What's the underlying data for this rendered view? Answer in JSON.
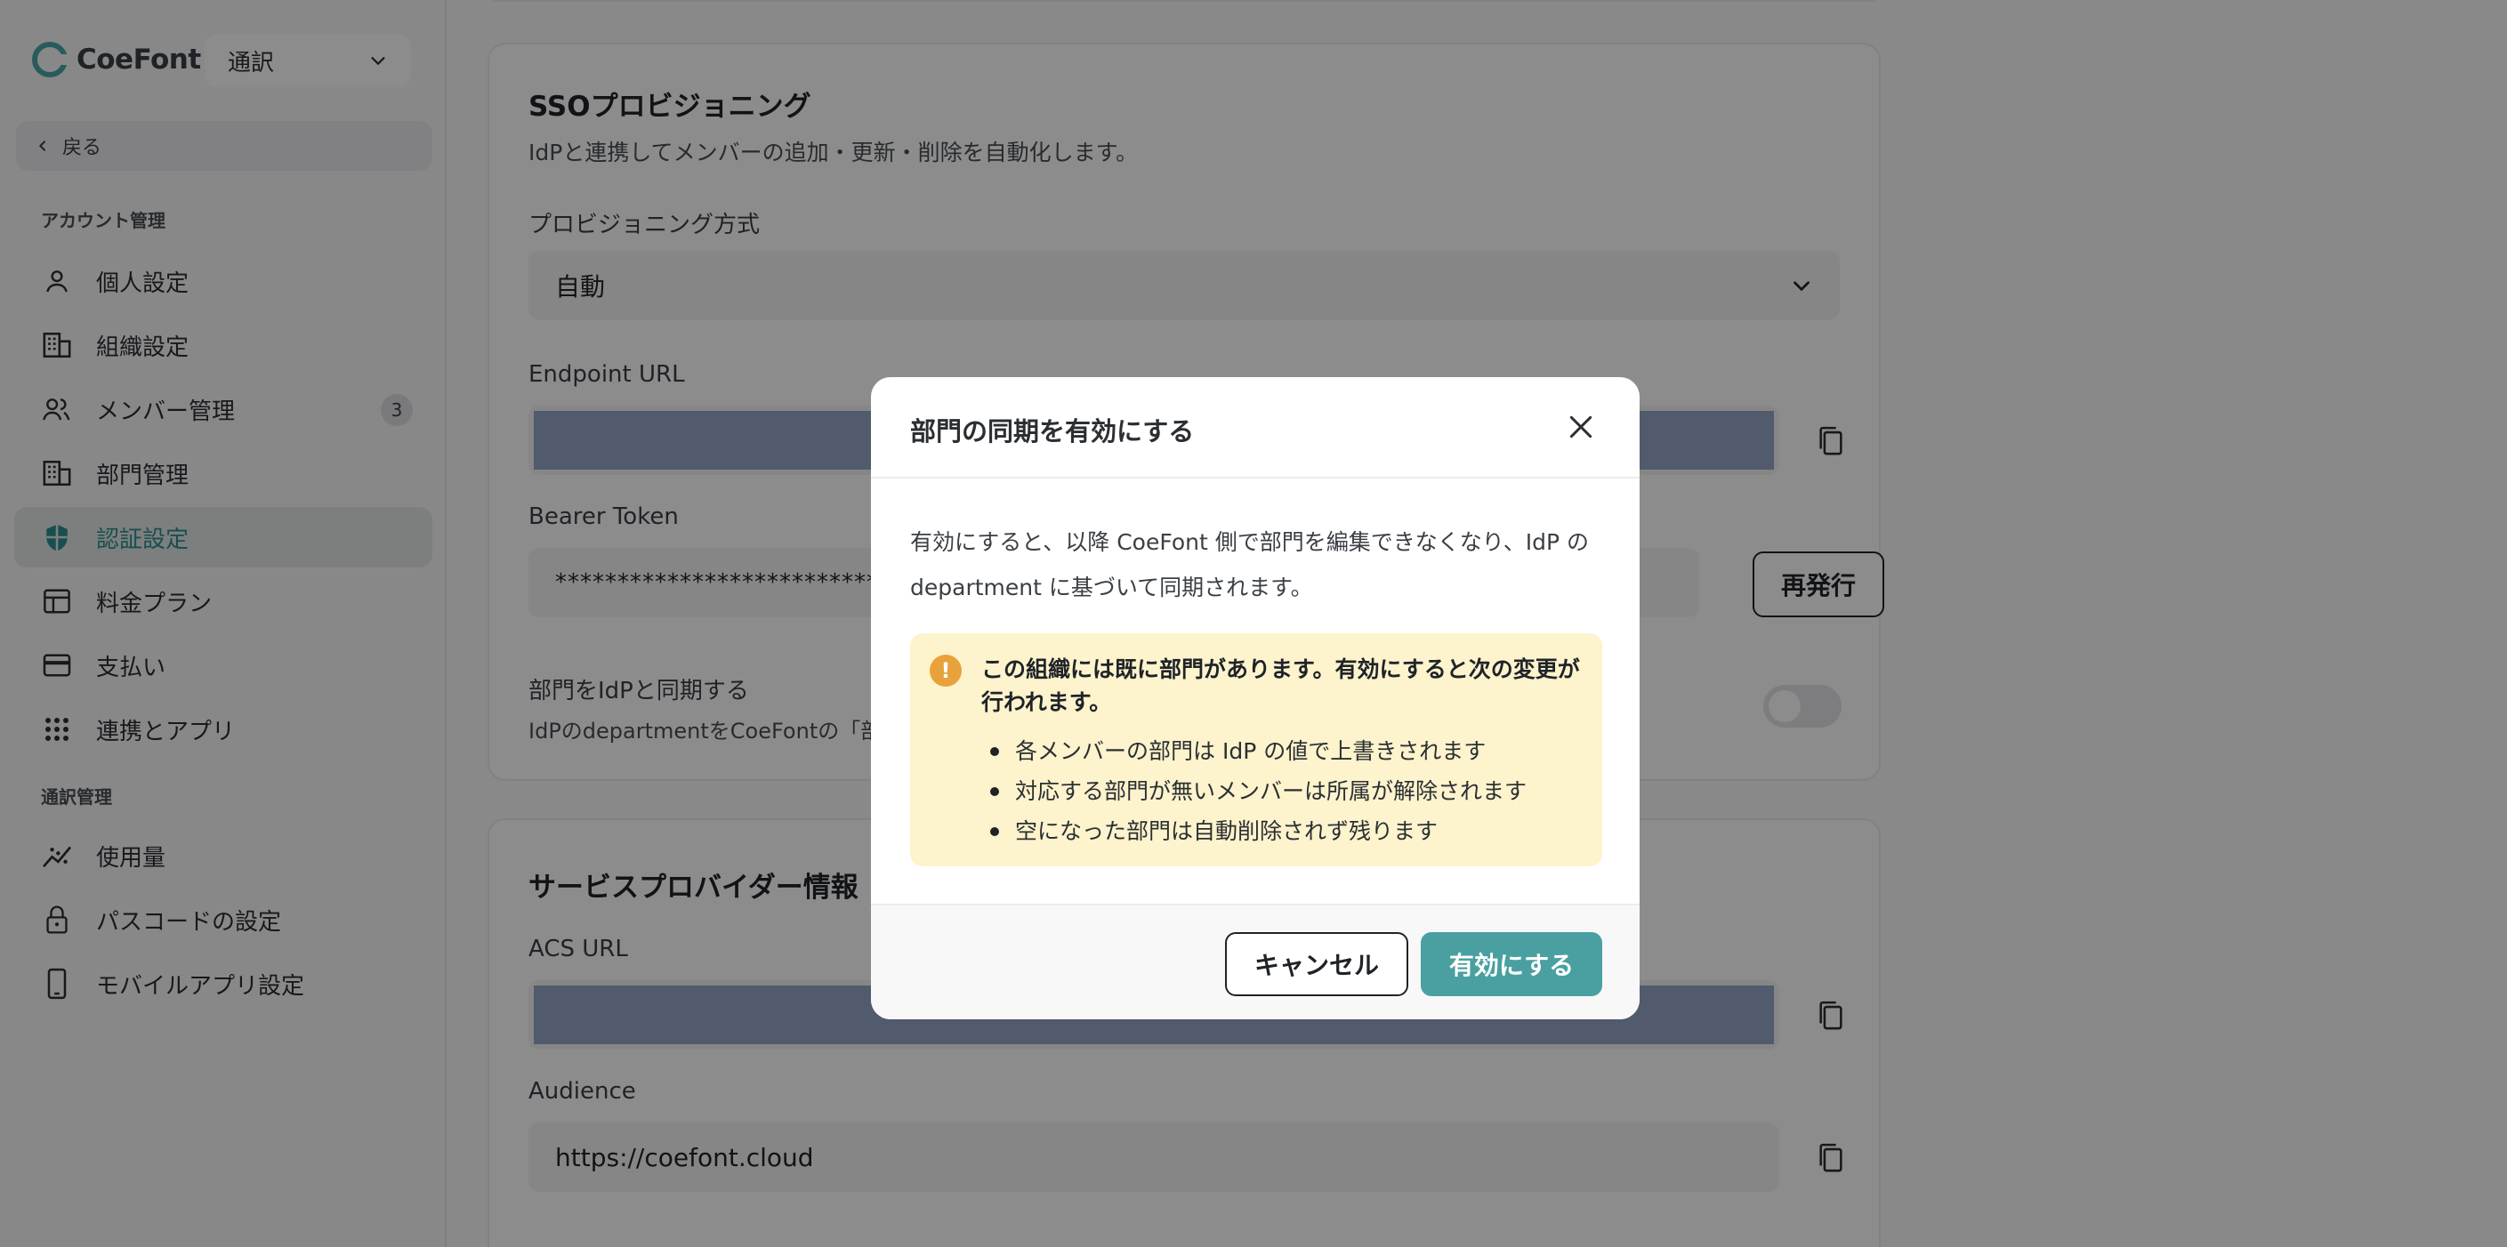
{
  "brand": {
    "name": "CoeFont"
  },
  "mode_select": {
    "value": "通訳"
  },
  "back": {
    "label": "戻る"
  },
  "sidebar": {
    "account_section": "アカウント管理",
    "account_items": [
      {
        "label": "個人設定",
        "icon": "user-icon"
      },
      {
        "label": "組織設定",
        "icon": "building-icon"
      },
      {
        "label": "メンバー管理",
        "icon": "users-icon",
        "badge": "3"
      },
      {
        "label": "部門管理",
        "icon": "building-icon"
      },
      {
        "label": "認証設定",
        "icon": "shield-icon",
        "active": true
      },
      {
        "label": "料金プラン",
        "icon": "calendar-table-icon"
      },
      {
        "label": "支払い",
        "icon": "credit-card-icon"
      },
      {
        "label": "連携とアプリ",
        "icon": "grid-dots-icon"
      }
    ],
    "interp_section": "通訳管理",
    "interp_items": [
      {
        "label": "使用量",
        "icon": "chart-line-icon"
      },
      {
        "label": "パスコードの設定",
        "icon": "lock-icon"
      },
      {
        "label": "モバイルアプリ設定",
        "icon": "mobile-icon"
      }
    ]
  },
  "sso": {
    "title": "SSOプロビジョニング",
    "description": "IdPと連携してメンバーの追加・更新・削除を自動化します。",
    "method_label": "プロビジョニング方式",
    "method_value": "自動",
    "endpoint_label": "Endpoint URL",
    "token_label": "Bearer Token",
    "token_value": "**********************************************",
    "reissue_label": "再発行",
    "sync_label": "部門をIdPと同期する",
    "sync_desc": "IdPのdepartmentをCoeFontの「部門"
  },
  "sp": {
    "title": "サービスプロバイダー情報",
    "acs_label": "ACS URL",
    "audience_label": "Audience",
    "audience_value": "https://coefont.cloud"
  },
  "modal": {
    "title": "部門の同期を有効にする",
    "body": "有効にすると、以降 CoeFont 側で部門を編集できなくなり、IdP の department に基づいて同期されます。",
    "warning_title": "この組織には既に部門があります。有効にすると次の変更が行われます。",
    "warning_items": [
      "各メンバーの部門は IdP の値で上書きされます",
      "対応する部門が無いメンバーは所属が解除されます",
      "空になった部門は自動削除されず残ります"
    ],
    "cancel_label": "キャンセル",
    "confirm_label": "有効にする"
  },
  "colors": {
    "accent": "#4aa0a0",
    "warning_bg": "#fdf3cc",
    "warning_icon": "#e9a23b"
  }
}
